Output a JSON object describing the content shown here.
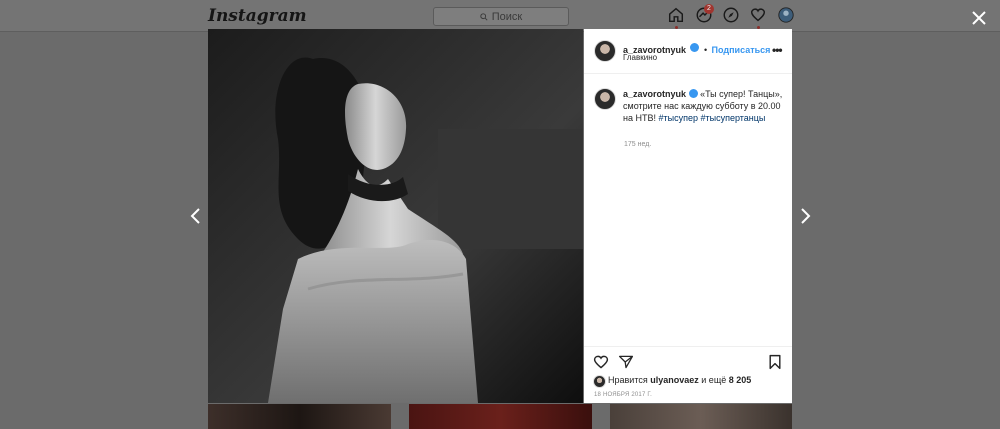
{
  "header": {
    "logo": "Instagram",
    "search_placeholder": "Поиск",
    "activity_badge": "2"
  },
  "post": {
    "author": "a_zavorotnyuk",
    "follow_label": "Подписаться",
    "location": "Главкино",
    "caption_text": "«Ты супер! Танцы», смотрите нас каждую субботу в 20.00 на НТВ!",
    "hashtags": [
      "#тысупер",
      "#тысупертанцы"
    ],
    "time_ago": "175 нед.",
    "likes_prefix": "Нравится",
    "liked_by": "ulyanovaez",
    "likes_suffix": "и ещё",
    "likes_count": "8 205",
    "date": "18 НОЯБРЯ 2017 Г."
  },
  "colors": {
    "accent": "#3897f0",
    "hashtag": "#003569",
    "overlay": "#6b6b6b"
  }
}
